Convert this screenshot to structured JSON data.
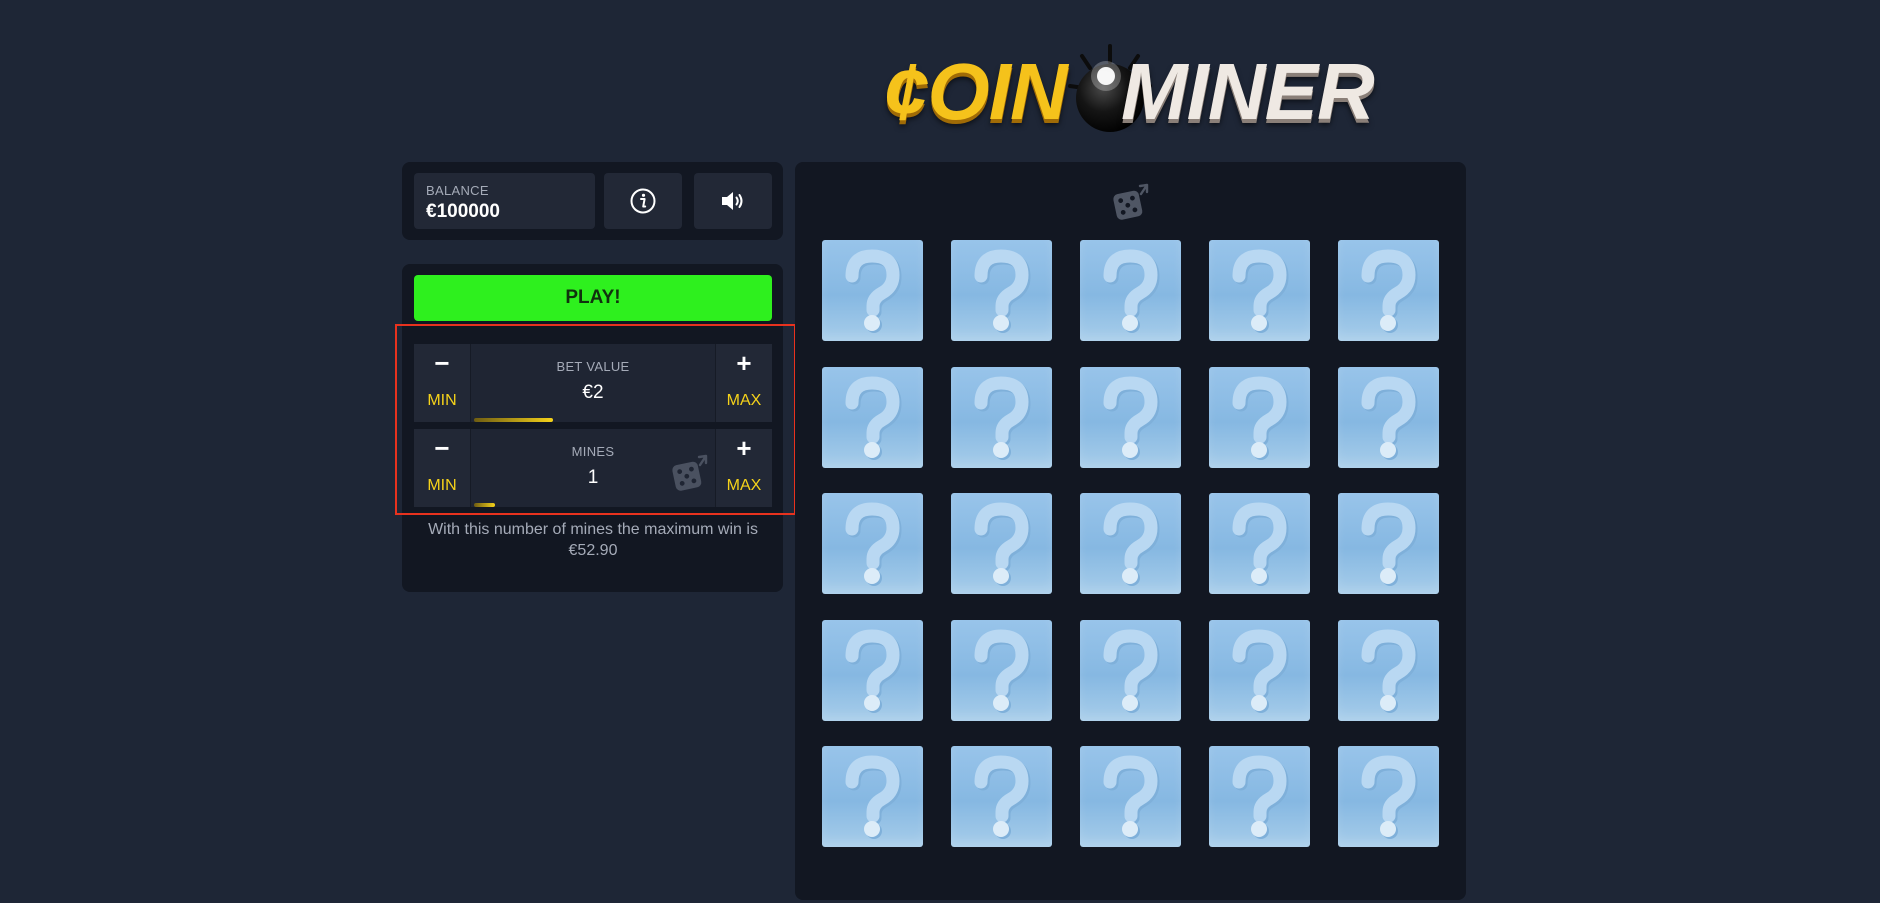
{
  "logo": {
    "part1": "¢OIN",
    "part2": "MINER"
  },
  "balance": {
    "label": "BALANCE",
    "value": "€100000"
  },
  "icons": {
    "info": "info-icon",
    "sound": "speaker-icon",
    "dice": "dice-icon"
  },
  "play": {
    "label": "PLAY!"
  },
  "bet": {
    "label": "BET VALUE",
    "value": "€2",
    "decrease": "−",
    "increase": "+",
    "min_label": "MIN",
    "max_label": "MAX",
    "level_fraction": 0.33
  },
  "mines": {
    "label": "MINES",
    "value": "1",
    "decrease": "−",
    "increase": "+",
    "min_label": "MIN",
    "max_label": "MAX",
    "level_fraction": 0.09
  },
  "max_win": {
    "text": "With this number of mines the maximum win is €52.90"
  },
  "board": {
    "rows": 5,
    "cols": 5,
    "tile_symbol": "?",
    "tile_state": "hidden"
  },
  "colors": {
    "background": "#1e2636",
    "panel": "#121722",
    "play_green": "#2ef01e",
    "accent_yellow": "#f5d21a",
    "tile_blue": "#8fbfe6",
    "highlight_red": "#e8321e"
  }
}
